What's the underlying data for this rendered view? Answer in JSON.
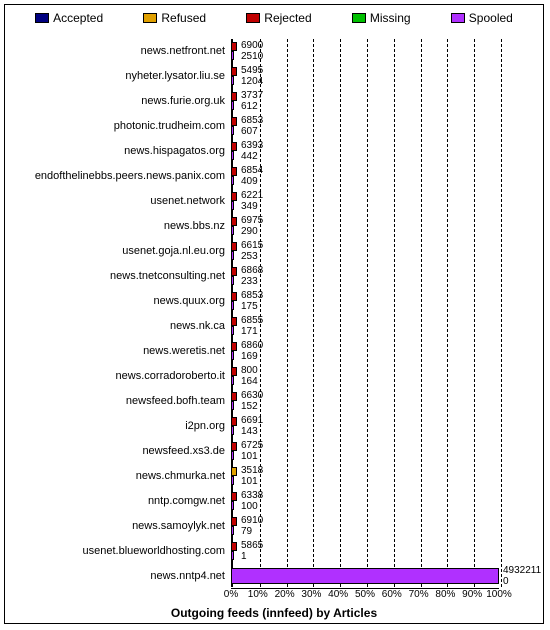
{
  "chart_data": {
    "type": "bar",
    "title": "Outgoing feeds (innfeed) by Articles",
    "xlabel": "",
    "ylabel": "",
    "legend": [
      {
        "key": "accepted",
        "label": "Accepted",
        "color": "#000080"
      },
      {
        "key": "refused",
        "label": "Refused",
        "color": "#e0a000"
      },
      {
        "key": "rejected",
        "label": "Rejected",
        "color": "#c00000"
      },
      {
        "key": "missing",
        "label": "Missing",
        "color": "#00c000"
      },
      {
        "key": "spooled",
        "label": "Spooled",
        "color": "#b030ff"
      }
    ],
    "xticks": [
      "0%",
      "10%",
      "20%",
      "30%",
      "40%",
      "50%",
      "60%",
      "70%",
      "80%",
      "90%",
      "100%"
    ],
    "categories": [
      "news.netfront.net",
      "nyheter.lysator.liu.se",
      "news.furie.org.uk",
      "photonic.trudheim.com",
      "news.hispagatos.org",
      "endofthelinebbs.peers.news.panix.com",
      "usenet.network",
      "news.bbs.nz",
      "usenet.goja.nl.eu.org",
      "news.tnetconsulting.net",
      "news.quux.org",
      "news.nk.ca",
      "news.weretis.net",
      "news.corradoroberto.it",
      "newsfeed.bofh.team",
      "i2pn.org",
      "newsfeed.xs3.de",
      "news.chmurka.net",
      "nntp.comgw.net",
      "news.samoylyk.net",
      "usenet.blueworldhosting.com",
      "news.nntp4.net"
    ],
    "rows": [
      {
        "bar1_kind": "rejected",
        "val1": 6900,
        "val2": 2510
      },
      {
        "bar1_kind": "rejected",
        "val1": 5495,
        "val2": 1204
      },
      {
        "bar1_kind": "rejected",
        "val1": 3737,
        "val2": 612
      },
      {
        "bar1_kind": "rejected",
        "val1": 6853,
        "val2": 607
      },
      {
        "bar1_kind": "rejected",
        "val1": 6393,
        "val2": 442
      },
      {
        "bar1_kind": "rejected",
        "val1": 6854,
        "val2": 409
      },
      {
        "bar1_kind": "rejected",
        "val1": 6221,
        "val2": 349
      },
      {
        "bar1_kind": "rejected",
        "val1": 6975,
        "val2": 290
      },
      {
        "bar1_kind": "rejected",
        "val1": 6615,
        "val2": 253
      },
      {
        "bar1_kind": "rejected",
        "val1": 6868,
        "val2": 233
      },
      {
        "bar1_kind": "rejected",
        "val1": 6853,
        "val2": 175
      },
      {
        "bar1_kind": "rejected",
        "val1": 6855,
        "val2": 171
      },
      {
        "bar1_kind": "rejected",
        "val1": 6860,
        "val2": 169
      },
      {
        "bar1_kind": "rejected",
        "val1": 800,
        "val2": 164
      },
      {
        "bar1_kind": "rejected",
        "val1": 6630,
        "val2": 152
      },
      {
        "bar1_kind": "rejected",
        "val1": 6691,
        "val2": 143
      },
      {
        "bar1_kind": "rejected",
        "val1": 6725,
        "val2": 101
      },
      {
        "bar1_kind": "refused",
        "val1": 3518,
        "val2": 101
      },
      {
        "bar1_kind": "rejected",
        "val1": 6338,
        "val2": 100
      },
      {
        "bar1_kind": "rejected",
        "val1": 6910,
        "val2": 79
      },
      {
        "bar1_kind": "rejected",
        "val1": 5865,
        "val2": 1
      },
      {
        "bar1_kind": "spooled",
        "val1": 4932211,
        "val2": 0,
        "full": true
      }
    ]
  }
}
